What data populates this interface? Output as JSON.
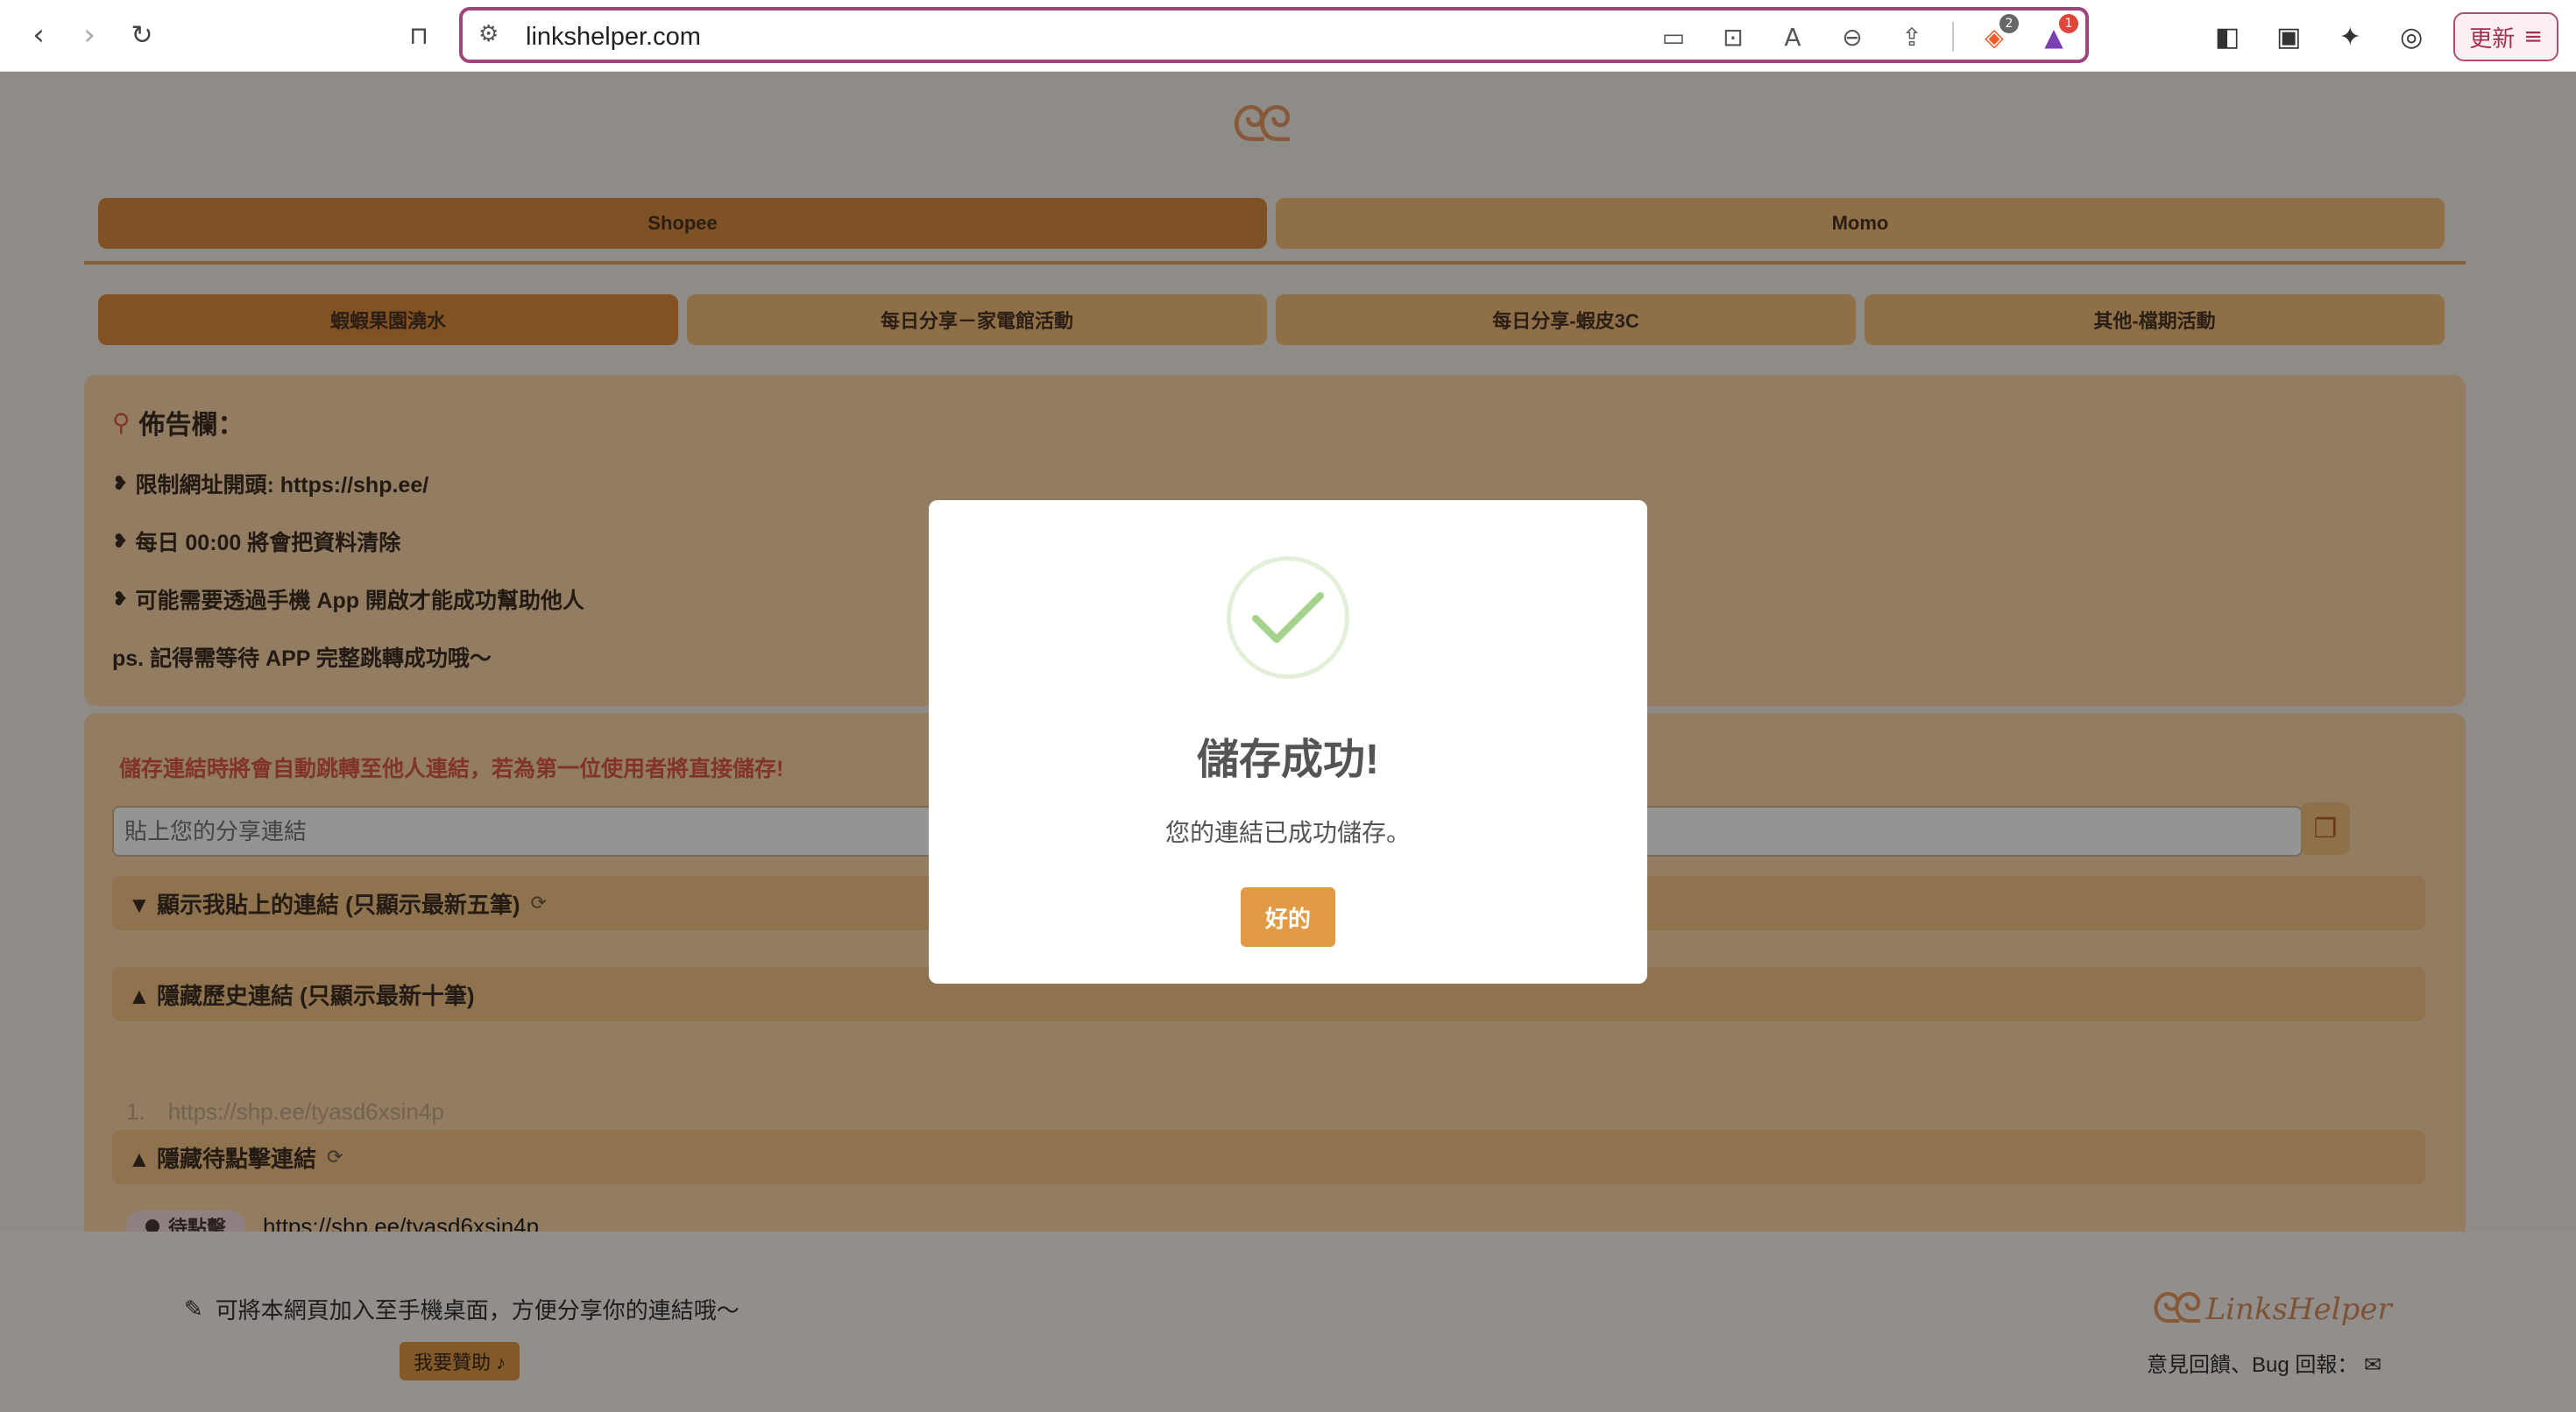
{
  "browser": {
    "url": "linkshelper.com",
    "update_label": "更新",
    "badges": {
      "brave": "2",
      "rewards": "1"
    },
    "icons": [
      "back-icon",
      "forward-icon",
      "reload-icon",
      "bookmark-icon",
      "site-settings-icon",
      "clipboard-icon",
      "install-app-icon",
      "translate-icon",
      "zoom-out-icon",
      "share-icon",
      "brave-shields-icon",
      "brave-rewards-icon",
      "sidebar-icon",
      "wallet-icon",
      "leo-ai-icon",
      "vpn-icon",
      "menu-icon"
    ]
  },
  "tabs": {
    "main": [
      "Shopee",
      "Momo"
    ],
    "sub": [
      "蝦蝦果園澆水",
      "每日分享－家電館活動",
      "每日分享-蝦皮3C",
      "其他-檔期活動"
    ]
  },
  "notice": {
    "title": "佈告欄：",
    "lines": [
      "限制網址開頭: https://shp.ee/",
      "每日 00:00 將會把資料清除",
      "可能需要透過手機 App 開啟才能成功幫助他人"
    ],
    "ps": "ps. 記得需等待 APP 完整跳轉成功哦～"
  },
  "form": {
    "warning": "儲存連結時將會自動跳轉至他人連結，若為第一位使用者將直接儲存!",
    "input_placeholder": "貼上您的分享連結",
    "my_links_label": "▼ 顯示我貼上的連結 (只顯示最新五筆)",
    "history_label": "▲ 隱藏歷史連結 (只顯示最新十筆)",
    "history_items": [
      {
        "index": "1.",
        "url": "https://shp.ee/tyasd6xsin4p"
      }
    ],
    "pending_label": "▲ 隱藏待點擊連結",
    "pending_badge": "待點擊",
    "pending_link": "https://shp.ee/tyasd6xsin4p"
  },
  "footer": {
    "tip": "可將本網頁加入至手機桌面，方便分享你的連結哦～",
    "sponsor": "我要贊助 ♪",
    "brand": "LinksHelper",
    "feedback": "意見回饋、Bug 回報："
  },
  "modal": {
    "title": "儲存成功!",
    "message": "您的連結已成功儲存。",
    "confirm": "好的"
  }
}
